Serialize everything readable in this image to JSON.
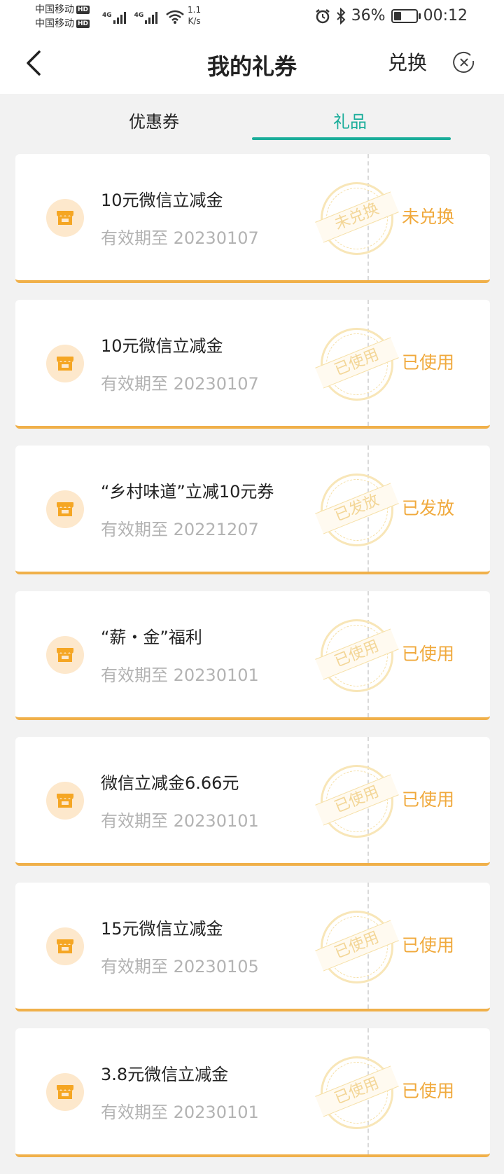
{
  "status_bar": {
    "carrier1": "中国移动",
    "carrier2": "中国移动",
    "hd": "HD",
    "net1": "4G",
    "net2": "4G",
    "speed_value": "1.1",
    "speed_unit": "K/s",
    "battery_percent": "36%",
    "battery_level": 0.36,
    "time": "00:12"
  },
  "nav": {
    "title": "我的礼券",
    "exchange_label": "兑换"
  },
  "tabs": [
    {
      "label": "优惠券",
      "active": false
    },
    {
      "label": "礼品",
      "active": true
    }
  ],
  "colors": {
    "accent": "#1aad9a",
    "gift_orange": "#f0a93c",
    "card_border": "#f0b04a"
  },
  "gifts": [
    {
      "title": "10元微信立减金",
      "date": "有效期至 20230107",
      "stamp": "未兑换",
      "status": "未兑换"
    },
    {
      "title": "10元微信立减金",
      "date": "有效期至 20230107",
      "stamp": "已使用",
      "status": "已使用"
    },
    {
      "title": "“乡村味道”立减10元券",
      "date": "有效期至 20221207",
      "stamp": "已发放",
      "status": "已发放"
    },
    {
      "title": "“薪・金”福利",
      "date": "有效期至 20230101",
      "stamp": "已使用",
      "status": "已使用"
    },
    {
      "title": "微信立减金6.66元",
      "date": "有效期至 20230101",
      "stamp": "已使用",
      "status": "已使用"
    },
    {
      "title": "15元微信立减金",
      "date": "有效期至 20230105",
      "stamp": "已使用",
      "status": "已使用"
    },
    {
      "title": "3.8元微信立减金",
      "date": "有效期至 20230101",
      "stamp": "已使用",
      "status": "已使用"
    }
  ]
}
